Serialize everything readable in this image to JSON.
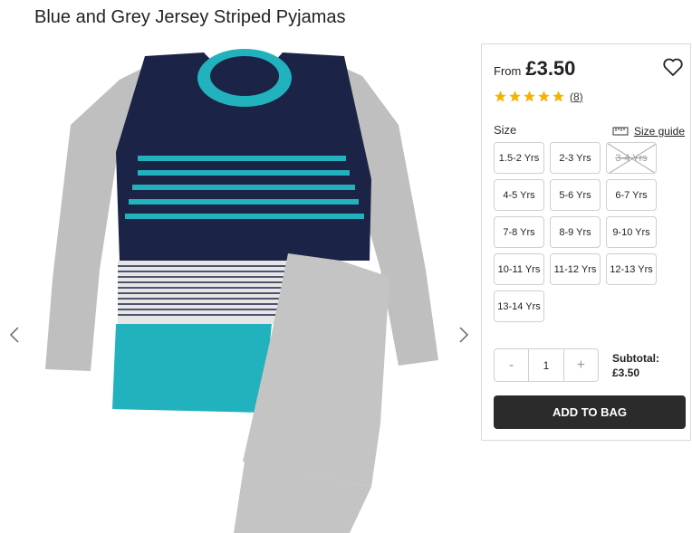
{
  "product": {
    "title": "Blue and Grey Jersey Striped Pyjamas"
  },
  "gallery": {
    "prev_icon": "chevron-left-icon",
    "next_icon": "chevron-right-icon",
    "image_description_colors": {
      "navy": "#1b2347",
      "teal": "#21b2bd",
      "grey": "#bdbdbd"
    }
  },
  "panel": {
    "from_label": "From",
    "price": "£3.50",
    "wishlist_icon": "heart-icon",
    "rating": {
      "stars": 5,
      "max": 5,
      "count": "(8)",
      "star_color": "#f5b301"
    },
    "size_label": "Size",
    "size_guide_label": "Size guide",
    "size_guide_icon": "ruler-icon",
    "sizes": [
      {
        "label": "1.5-2 Yrs",
        "available": true
      },
      {
        "label": "2-3 Yrs",
        "available": true
      },
      {
        "label": "3-4 Yrs",
        "available": false
      },
      {
        "label": "4-5 Yrs",
        "available": true
      },
      {
        "label": "5-6 Yrs",
        "available": true
      },
      {
        "label": "6-7 Yrs",
        "available": true
      },
      {
        "label": "7-8 Yrs",
        "available": true
      },
      {
        "label": "8-9 Yrs",
        "available": true
      },
      {
        "label": "9-10 Yrs",
        "available": true
      },
      {
        "label": "10-11 Yrs",
        "available": true
      },
      {
        "label": "11-12 Yrs",
        "available": true
      },
      {
        "label": "12-13 Yrs",
        "available": true
      },
      {
        "label": "13-14 Yrs",
        "available": true
      }
    ],
    "quantity": {
      "minus": "-",
      "value": "1",
      "plus": "+"
    },
    "subtotal_label": "Subtotal:",
    "subtotal_value": "£3.50",
    "add_to_bag_label": "ADD TO BAG",
    "add_to_bag_color": "#2b2b2b"
  }
}
